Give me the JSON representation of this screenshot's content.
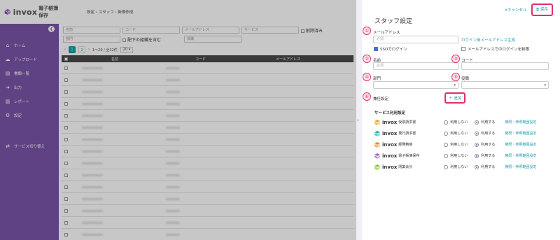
{
  "app": {
    "brand": "invox",
    "product": "電子帳簿保存"
  },
  "breadcrumb": "設定 › スタッフ › 新規作成",
  "sidebar": {
    "items": [
      {
        "icon": "home-icon",
        "glyph": "⌂",
        "label": "ホーム"
      },
      {
        "icon": "upload-icon",
        "glyph": "☁",
        "label": "アップロード"
      },
      {
        "icon": "document-icon",
        "glyph": "▤",
        "label": "書類一覧"
      },
      {
        "icon": "export-icon",
        "glyph": "➜",
        "label": "出力"
      },
      {
        "icon": "report-icon",
        "glyph": "▥",
        "label": "レポート"
      },
      {
        "icon": "gear-icon",
        "glyph": "⚙",
        "label": "設定"
      }
    ],
    "switch_label": "サービス切り替え"
  },
  "background": {
    "filters": {
      "name_placeholder": "名前",
      "code_placeholder": "コード",
      "email_placeholder": "メールアドレス",
      "service_placeholder": "サービス",
      "deleted_label": "削除済み",
      "department_placeholder": "部門",
      "include_sub_label": "配下の組織を含む",
      "position_placeholder": "役職"
    },
    "pager": {
      "page1": "1",
      "page2": "2",
      "range": "1〜20 / 全32件",
      "per_page": "20"
    },
    "table_headers": [
      "名前",
      "コード",
      "メールアドレス"
    ]
  },
  "panel": {
    "title": "スタッフ設定",
    "cancel_label": "✕キャンセル",
    "save_label": "保存",
    "email": {
      "label": "メールアドレス",
      "placeholder": "必須",
      "link": "ログイン用メールアドレス生成"
    },
    "sso_label": "SSOでログイン",
    "restrict_label": "メールアドレスでのログインを制限",
    "name": {
      "label": "名前",
      "placeholder": "必須"
    },
    "code": {
      "label": "コード",
      "placeholder": ""
    },
    "department": {
      "label": "部門"
    },
    "position": {
      "label": "役職"
    },
    "concurrent": {
      "label": "兼任設定",
      "add_label": "＋ 追加"
    },
    "markers": [
      "①",
      "②",
      "③",
      "④",
      "⑤",
      "⑥"
    ]
  },
  "services": {
    "title": "サービス利用設定",
    "off_label": "利用しない",
    "on_label": "利用する",
    "link_label": "権限・参照範囲設定",
    "rows": [
      {
        "brand": "invox",
        "name": "受取請求書",
        "color": "#f2a52a"
      },
      {
        "brand": "invox",
        "name": "発行請求書",
        "color": "#1fb5b0"
      },
      {
        "brand": "invox",
        "name": "経費精算",
        "color": "#f08a24"
      },
      {
        "brand": "invox",
        "name": "電子帳簿保存",
        "color": "#9b6fd0"
      },
      {
        "brand": "invox",
        "name": "閉業会計",
        "color": "#8cc63f"
      }
    ]
  },
  "colors": {
    "accent": "#1d9ca8",
    "highlight": "#e0306c",
    "sidebar": "#7a55a8"
  }
}
